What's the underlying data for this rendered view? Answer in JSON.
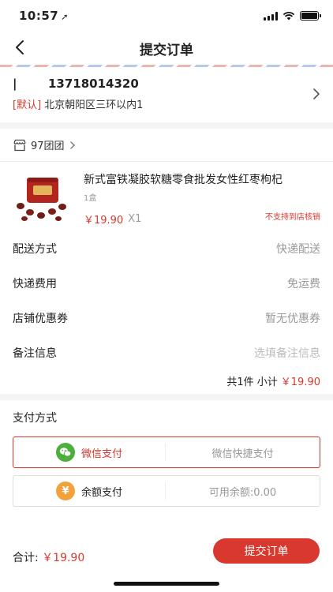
{
  "status_bar": {
    "time": "10:57",
    "location_glyph": "➚"
  },
  "navbar": {
    "title": "提交订单"
  },
  "address": {
    "name": "|",
    "phone": "13718014320",
    "default_tag": "[默认]",
    "detail": "北京朝阳区三环以内1"
  },
  "shop": {
    "name": "97团团"
  },
  "product": {
    "name": "新式富铁凝胶软糖零食批发女性红枣枸杞",
    "spec": "1盒",
    "price": "￥19.90",
    "qty": "X1",
    "notice": "不支持到店核销"
  },
  "rows": [
    {
      "label": "配送方式",
      "value": "快递配送",
      "placeholder": false
    },
    {
      "label": "快递费用",
      "value": "免运费",
      "placeholder": false
    },
    {
      "label": "店铺优惠券",
      "value": "暂无优惠券",
      "placeholder": false
    },
    {
      "label": "备注信息",
      "value": "选填备注信息",
      "placeholder": true
    }
  ],
  "subtotal": {
    "label": "共1件 小计",
    "amount": "￥19.90"
  },
  "payment": {
    "title": "支付方式",
    "options": [
      {
        "label": "微信支付",
        "desc": "微信快捷支付",
        "icon": "wechat-icon",
        "icon_color": "#4caf3c",
        "selected": true
      },
      {
        "label": "余额支付",
        "desc": "可用余额:0.00",
        "icon": "yen-icon",
        "icon_color": "#f3a13b",
        "selected": false
      }
    ]
  },
  "footer": {
    "total_label": "合计:",
    "total_amount": "￥19.90",
    "submit_label": "提交订单"
  },
  "colors": {
    "accent": "#d8382d"
  }
}
